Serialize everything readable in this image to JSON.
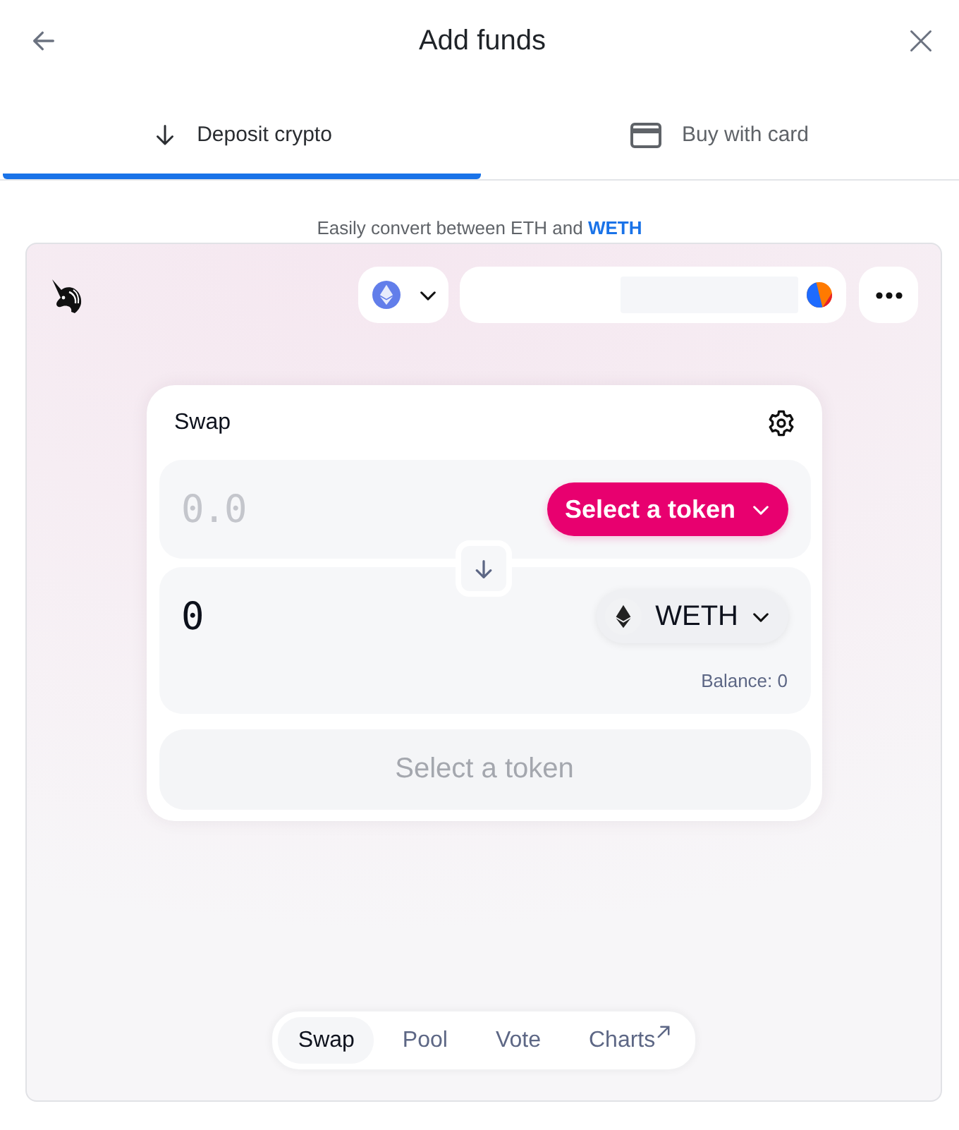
{
  "window": {
    "title": "Add funds"
  },
  "tabs": [
    {
      "label": "Deposit crypto",
      "selected": true,
      "kind": "deposit"
    },
    {
      "label": "Buy with card",
      "selected": false,
      "kind": "card"
    }
  ],
  "hint": {
    "text": "Easily convert between ETH and",
    "link": "WETH"
  },
  "swap_widget": {
    "card": {
      "title": "Swap",
      "sell": {
        "placeholder": "0.0",
        "token_button": "Select a token"
      },
      "buy": {
        "value": "0",
        "token": "WETH",
        "balance": "Balance: 0"
      },
      "action_button": {
        "label": "Select a token",
        "disabled": true
      }
    },
    "nav": [
      {
        "label": "Swap",
        "selected": true,
        "external": false
      },
      {
        "label": "Pool",
        "selected": false,
        "external": false
      },
      {
        "label": "Vote",
        "selected": false,
        "external": false
      },
      {
        "label": "Charts",
        "selected": false,
        "external": true
      }
    ]
  }
}
